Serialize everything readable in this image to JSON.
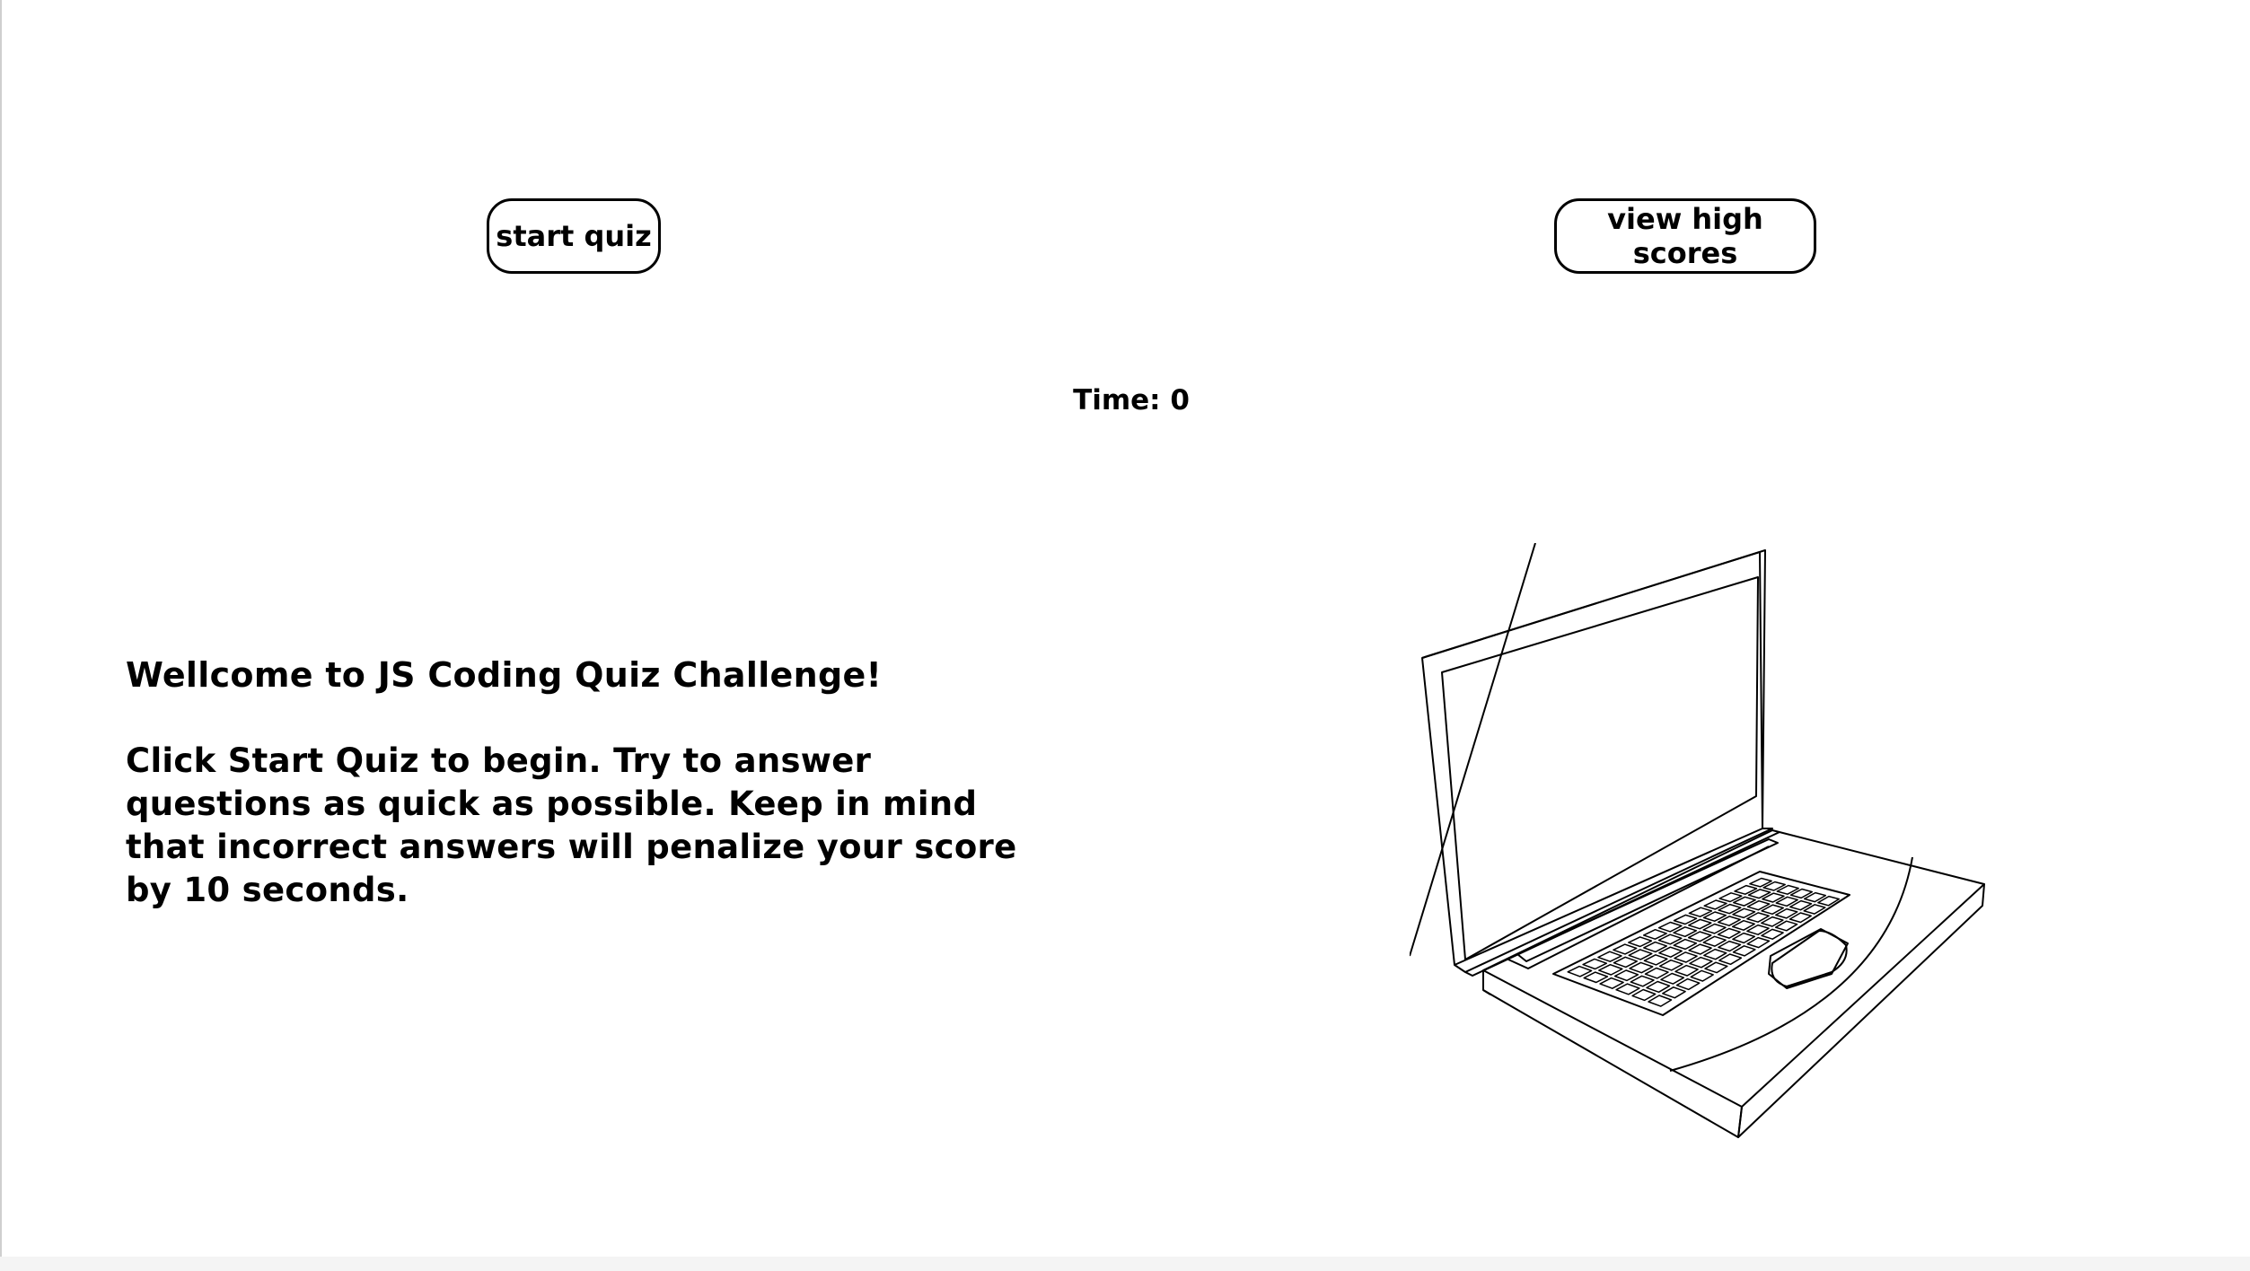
{
  "header": {
    "start_button_label": "start quiz",
    "high_scores_button_label": "view high scores"
  },
  "timer": {
    "label": "Time:",
    "value": "0"
  },
  "intro": {
    "title": "Wellcome to JS Coding Quiz Challenge!",
    "instructions": "Click Start Quiz to begin. Try to answer questions as quick as possible. Keep in mind that incorrect answers will penalize your score by 10 seconds."
  },
  "illustration": {
    "icon": "laptop-illustration-icon"
  }
}
